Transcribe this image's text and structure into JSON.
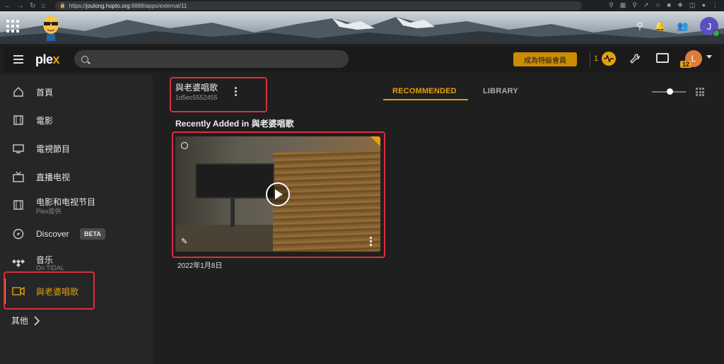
{
  "browser": {
    "url_scheme": "https://",
    "url_host": "joulong.hopto.org",
    "url_path": ":8888/apps/external/11"
  },
  "banner": {
    "user_initial": "J"
  },
  "topbar": {
    "logo_text": "ple",
    "logo_accent": "x",
    "search_placeholder": "",
    "premium_label": "成為特級會員",
    "activity_count": "1",
    "user_initial": "L",
    "user_badge": "12"
  },
  "sidebar": {
    "items": [
      {
        "label": "首頁",
        "icon": "home-icon"
      },
      {
        "label": "電影",
        "icon": "film-icon"
      },
      {
        "label": "電視節目",
        "icon": "tv-icon"
      },
      {
        "label": "直播电视",
        "icon": "live-tv-icon"
      },
      {
        "label": "电影和电视节目",
        "sub": "Plex提供",
        "icon": "film-icon"
      },
      {
        "label": "Discover",
        "badge": "BETA",
        "icon": "compass-icon"
      },
      {
        "label": "音乐",
        "sub": "On TIDAL",
        "icon": "tidal-icon"
      },
      {
        "label": "與老婆唱歌",
        "icon": "video-camera-icon",
        "active": true
      }
    ],
    "other_label": "其他"
  },
  "library": {
    "title": "與老婆唱歌",
    "id": "1d5ec5552455",
    "tabs": [
      "RECOMMENDED",
      "LIBRARY"
    ],
    "active_tab": "RECOMMENDED",
    "section_title": "Recently Added in 與老婆唱歌",
    "items": [
      {
        "date": "2022年1月8日"
      }
    ]
  },
  "colors": {
    "accent": "#e5a00d",
    "highlight_box": "#d9303c",
    "sidebar_bg": "#262626",
    "main_bg": "#1f1f1f"
  }
}
